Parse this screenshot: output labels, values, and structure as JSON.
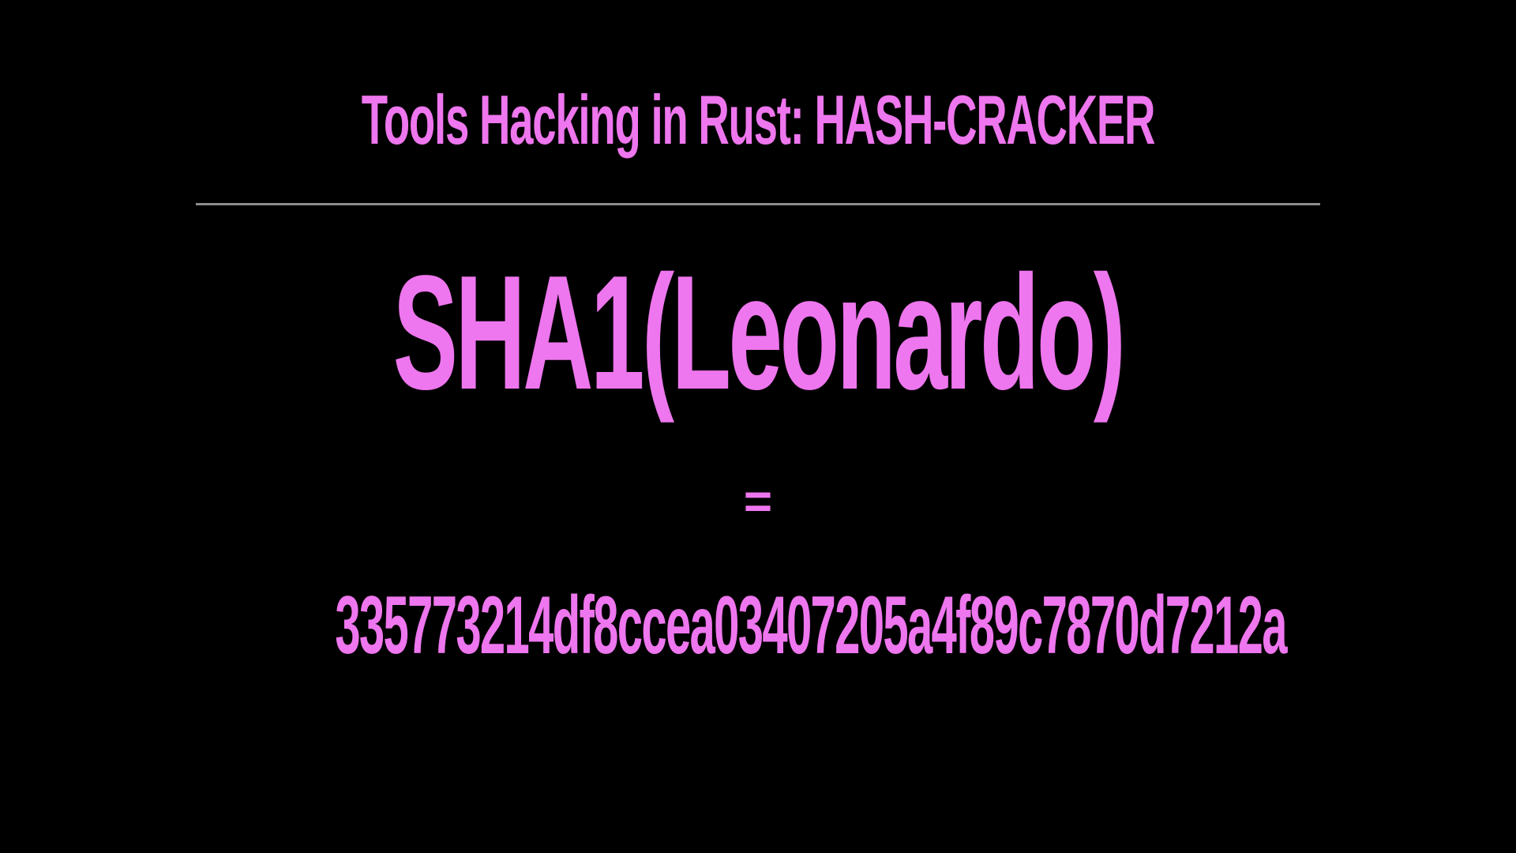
{
  "slide": {
    "title": "Tools Hacking in Rust: HASH-CRACKER",
    "expression": "SHA1(Leonardo)",
    "equals": "=",
    "hash": "335773214df8ccea03407205a4f89c7870d7212a"
  },
  "colors": {
    "background": "#000000",
    "text": "#ee76ee",
    "divider": "#8c8c8c"
  }
}
